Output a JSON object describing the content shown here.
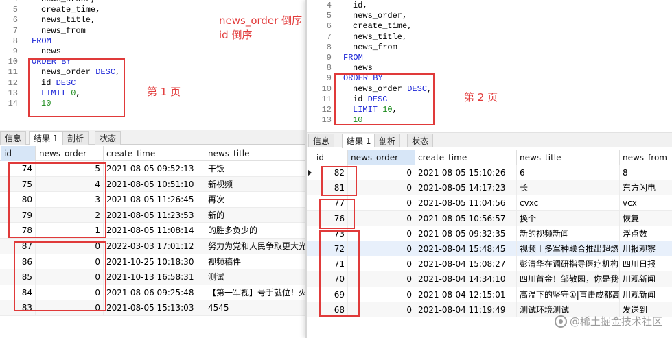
{
  "left_panel": {
    "code_lines": [
      {
        "n": "4",
        "parts": [
          {
            "t": "news_order,",
            "c": ""
          }
        ]
      },
      {
        "n": "5",
        "parts": [
          {
            "t": "create_time,",
            "c": ""
          }
        ]
      },
      {
        "n": "6",
        "parts": [
          {
            "t": "news_title,",
            "c": ""
          }
        ]
      },
      {
        "n": "7",
        "parts": [
          {
            "t": "news_from",
            "c": ""
          }
        ]
      },
      {
        "n": "8",
        "parts": [
          {
            "t": "FROM",
            "c": "kw"
          }
        ]
      },
      {
        "n": "9",
        "parts": [
          {
            "t": "news",
            "c": ""
          }
        ]
      },
      {
        "n": "10",
        "parts": [
          {
            "t": "ORDER BY",
            "c": "kw"
          }
        ]
      },
      {
        "n": "11",
        "parts": [
          {
            "t": "news_order ",
            "c": ""
          },
          {
            "t": "DESC",
            "c": "kw"
          },
          {
            "t": ",",
            "c": ""
          }
        ]
      },
      {
        "n": "12",
        "parts": [
          {
            "t": "id ",
            "c": ""
          },
          {
            "t": "DESC",
            "c": "kw"
          }
        ]
      },
      {
        "n": "13",
        "parts": [
          {
            "t": "LIMIT ",
            "c": "kw"
          },
          {
            "t": "0",
            "c": "num"
          },
          {
            "t": ",",
            "c": ""
          }
        ]
      },
      {
        "n": "14",
        "parts": [
          {
            "t": "10",
            "c": "num"
          }
        ]
      }
    ],
    "annotation_sort_1": "news_order 倒序",
    "annotation_sort_2": "id 倒序",
    "annotation_page": "第 1 页",
    "tabs": [
      "信息",
      "结果 1",
      "剖析",
      "状态"
    ],
    "active_tab": 1,
    "columns": [
      "id",
      "news_order",
      "create_time",
      "news_title"
    ],
    "rows": [
      [
        "74",
        "5",
        "2021-08-05 09:52:13",
        "干饭"
      ],
      [
        "75",
        "4",
        "2021-08-05 10:51:10",
        "新视频"
      ],
      [
        "80",
        "3",
        "2021-08-05 11:26:45",
        "再次"
      ],
      [
        "79",
        "2",
        "2021-08-05 11:23:53",
        "新的"
      ],
      [
        "78",
        "1",
        "2021-08-05 11:08:14",
        "的胜多负少的"
      ],
      [
        "87",
        "0",
        "2022-03-03 17:01:12",
        "努力为党和人民争取更大光"
      ],
      [
        "86",
        "0",
        "2021-10-25 10:18:30",
        "视频稿件"
      ],
      [
        "85",
        "0",
        "2021-10-13 16:58:31",
        "测试"
      ],
      [
        "84",
        "0",
        "2021-08-06 09:25:48",
        "【第一军视】号手就位！火"
      ],
      [
        "83",
        "0",
        "2021-08-05 15:13:03",
        "4545"
      ]
    ]
  },
  "right_panel": {
    "code_lines": [
      {
        "n": "4",
        "parts": [
          {
            "t": "id,",
            "c": ""
          }
        ]
      },
      {
        "n": "5",
        "parts": [
          {
            "t": "news_order,",
            "c": ""
          }
        ]
      },
      {
        "n": "6",
        "parts": [
          {
            "t": "create_time,",
            "c": ""
          }
        ]
      },
      {
        "n": "7",
        "parts": [
          {
            "t": "news_title,",
            "c": ""
          }
        ]
      },
      {
        "n": "8",
        "parts": [
          {
            "t": "news_from",
            "c": ""
          }
        ]
      },
      {
        "n": "9",
        "parts": [
          {
            "t": "FROM",
            "c": "kw"
          }
        ]
      },
      {
        "n": "8",
        "parts": [
          {
            "t": "news",
            "c": ""
          }
        ]
      },
      {
        "n": "9",
        "parts": [
          {
            "t": "ORDER BY",
            "c": "kw"
          }
        ]
      },
      {
        "n": "10",
        "parts": [
          {
            "t": "news_order ",
            "c": ""
          },
          {
            "t": "DESC",
            "c": "kw"
          },
          {
            "t": ",",
            "c": ""
          }
        ]
      },
      {
        "n": "11",
        "parts": [
          {
            "t": "id ",
            "c": ""
          },
          {
            "t": "DESC",
            "c": "kw"
          }
        ]
      },
      {
        "n": "12",
        "parts": [
          {
            "t": "LIMIT ",
            "c": "kw"
          },
          {
            "t": "10",
            "c": "num"
          },
          {
            "t": ",",
            "c": ""
          }
        ]
      },
      {
        "n": "13",
        "parts": [
          {
            "t": "10",
            "c": "num"
          }
        ]
      }
    ],
    "annotation_page": "第 2 页",
    "tabs": [
      "信息",
      "结果 1",
      "剖析",
      "状态"
    ],
    "active_tab": 1,
    "columns": [
      "id",
      "news_order",
      "create_time",
      "news_title",
      "news_from"
    ],
    "rows": [
      [
        "82",
        "0",
        "2021-08-05 15:10:26",
        "6",
        "8"
      ],
      [
        "81",
        "0",
        "2021-08-05 14:17:23",
        "长",
        "东方闪电"
      ],
      [
        "77",
        "0",
        "2021-08-05 11:04:56",
        "cvxc",
        "vcx"
      ],
      [
        "76",
        "0",
        "2021-08-05 10:56:57",
        "换个",
        "恢复"
      ],
      [
        "73",
        "0",
        "2021-08-05 09:32:35",
        "新的视频新闻",
        "浮点数"
      ],
      [
        "72",
        "0",
        "2021-08-04 15:48:45",
        "视频丨多军种联合推出超燃",
        "川报观察"
      ],
      [
        "71",
        "0",
        "2021-08-04 15:08:27",
        "彭清华在调研指导医疗机构",
        "四川日报"
      ],
      [
        "70",
        "0",
        "2021-08-04 14:34:10",
        "四川首金！邹敬园，你是我们",
        "川观新闻"
      ],
      [
        "69",
        "0",
        "2021-08-04 12:15:01",
        "高温下的坚守①|直击成都高",
        "川观新闻"
      ],
      [
        "68",
        "0",
        "2021-08-04 11:19:49",
        "测试环境测试",
        "发送到"
      ]
    ]
  },
  "watermark": "@稀土掘金技术社区",
  "colors": {
    "annotation": "#e23b3b",
    "keyword": "#1a24d6",
    "number": "#1a8a1a",
    "box": "#e03a3a"
  }
}
